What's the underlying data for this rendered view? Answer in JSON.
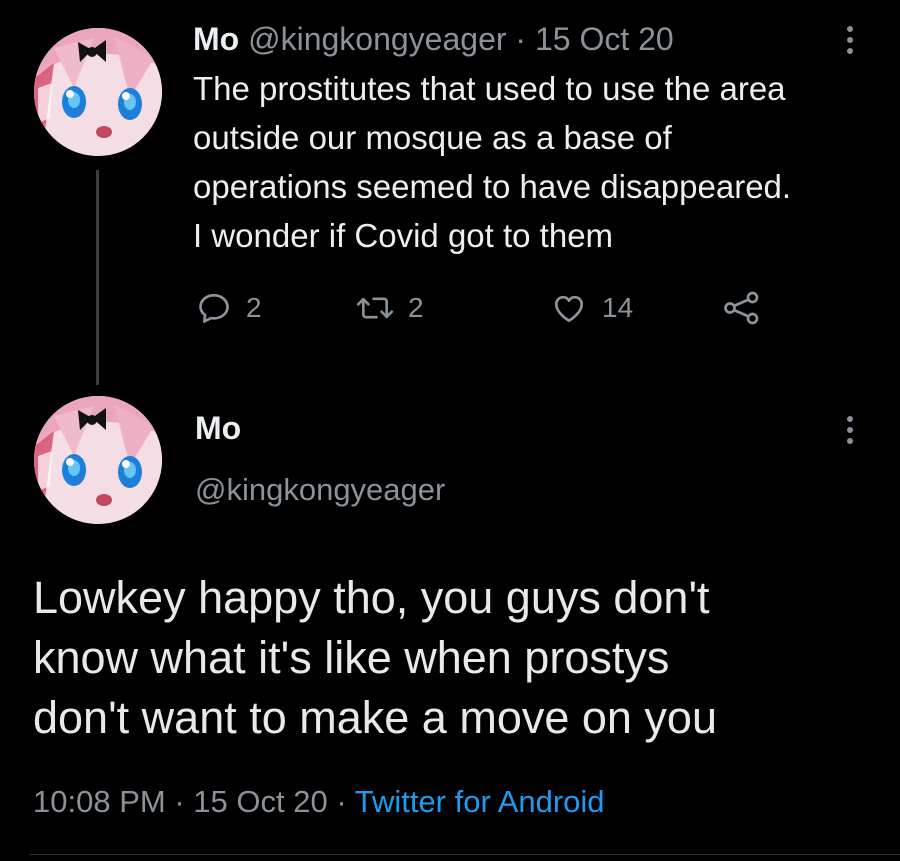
{
  "tweet1": {
    "name": "Mo",
    "handle": "@kingkongyeager",
    "date": "15 Oct 20",
    "separator": "·",
    "text_lines": [
      "The prostitutes that used to use the area",
      "outside our mosque as a base of",
      "operations seemed to have disappeared.",
      "I wonder if Covid got to them"
    ],
    "replies": "2",
    "retweets": "2",
    "likes": "14",
    "icons": [
      "reply-icon",
      "retweet-icon",
      "like-icon",
      "share-icon",
      "more-options-icon"
    ]
  },
  "tweet2": {
    "name": "Mo",
    "handle": "@kingkongyeager",
    "text_lines": [
      "Lowkey happy tho, you guys don't",
      "know what it's like when prostys",
      "don't want to make a move on you"
    ],
    "time": "10:08 PM",
    "date": "15 Oct 20",
    "separator": "·",
    "source": "Twitter for Android"
  },
  "colors": {
    "background": "#000000",
    "text": "#e7e9ea",
    "secondary": "#8b9299",
    "link": "#1d9bf0"
  }
}
